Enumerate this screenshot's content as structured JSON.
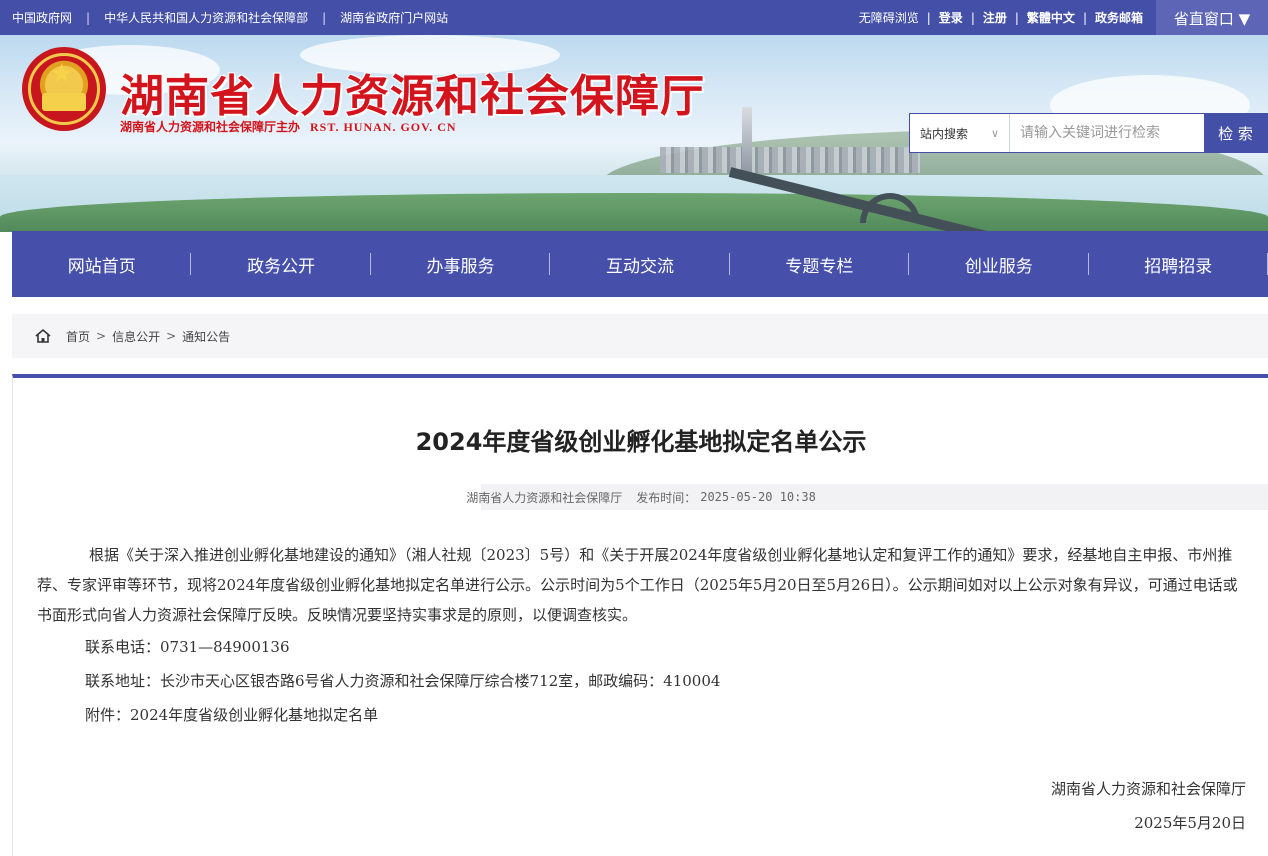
{
  "topbar": {
    "left_links": [
      "中国政府网",
      "中华人民共和国人力资源和社会保障部",
      "湖南省政府门户网站"
    ],
    "accessibility": "无障碍浏览",
    "login": "登录",
    "register": "注册",
    "traditional": "繁體中文",
    "email": "政务邮箱",
    "window_button": "省直窗口 ▼",
    "bar_color": "#4450a8"
  },
  "header": {
    "site_title": "湖南省人力资源和社会保障厅",
    "host_line": "湖南省人力资源和社会保障厅主办",
    "domain": "RST. HUNAN. GOV. CN",
    "emblem_icon": "national-emblem-icon"
  },
  "search": {
    "scope": "站内搜索",
    "placeholder": "请输入关键词进行检索",
    "button": "检 索"
  },
  "nav": {
    "items": [
      "网站首页",
      "政务公开",
      "办事服务",
      "互动交流",
      "专题专栏",
      "创业服务",
      "招聘招录"
    ],
    "color": "#4650ab"
  },
  "breadcrumb": {
    "icon": "home-icon",
    "items": [
      "首页",
      "信息公开",
      "通知公告"
    ],
    "separator": ">"
  },
  "article": {
    "title": "2024年度省级创业孵化基地拟定名单公示",
    "publisher": "湖南省人力资源和社会保障厅",
    "time_label": "发布时间：",
    "time": "2025-05-20 10:38",
    "paragraph": "根据《关于深入推进创业孵化基地建设的通知》（湘人社规〔2023〕5号）和《关于开展2024年度省级创业孵化基地认定和复评工作的通知》要求，经基地自主申报、市州推荐、专家评审等环节，现将2024年度省级创业孵化基地拟定名单进行公示。公示时间为5个工作日（2025年5月20日至5月26日）。公示期间如对以上公示对象有异议，可通过电话或书面形式向省人力资源社会保障厅反映。反映情况要坚持实事求是的原则，以便调查核实。",
    "phone": "联系电话：0731—84900136",
    "address": "联系地址：长沙市天心区银杏路6号省人力资源和社会保障厅综合楼712室，邮政编码：410004",
    "attachment": "附件：2024年度省级创业孵化基地拟定名单",
    "sign_org": "湖南省人力资源和社会保障厅",
    "sign_date": "2025年5月20日"
  }
}
